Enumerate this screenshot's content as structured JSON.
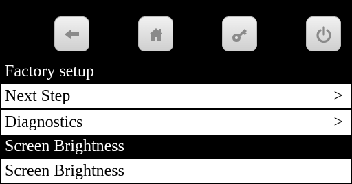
{
  "toolbar": {
    "buttons": [
      {
        "icon": "back-arrow-icon"
      },
      {
        "icon": "home-icon"
      },
      {
        "icon": "key-icon"
      },
      {
        "icon": "power-icon"
      }
    ]
  },
  "menu": {
    "header": "Factory setup",
    "items": [
      {
        "label": "Next Step",
        "arrow": ">"
      },
      {
        "label": "Diagnostics",
        "arrow": ">"
      }
    ],
    "section_header": "Screen Brightness",
    "section_item": "Screen Brightness"
  },
  "colors": {
    "bar": "#000000",
    "text_on_bar": "#ffffff",
    "button_face": "#e6e6e6",
    "icon": "#8a8a8a"
  }
}
